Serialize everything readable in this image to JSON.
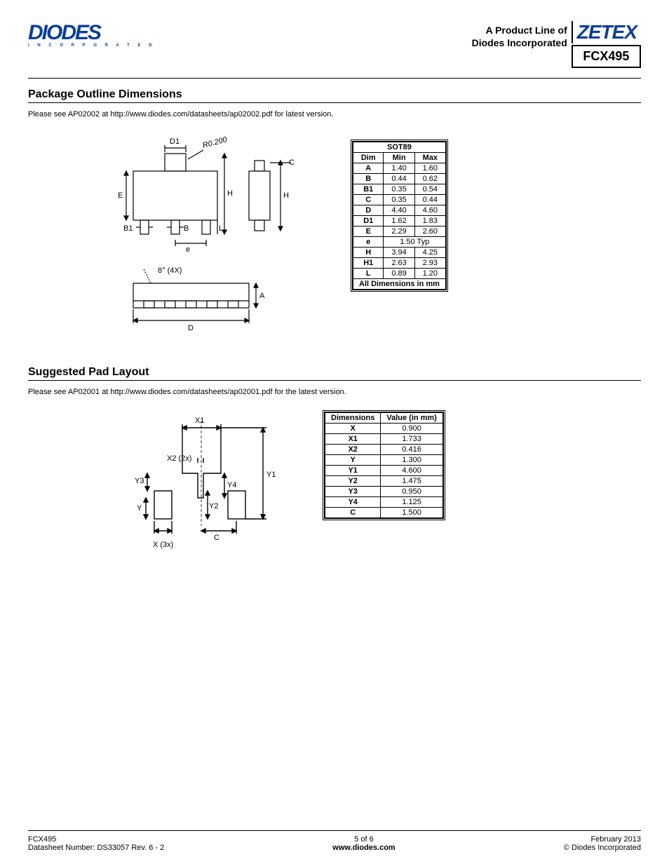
{
  "header": {
    "logo_main": "DIODES",
    "logo_sub": "I N C O R P O R A T E D",
    "prodline1": "A Product Line of",
    "prodline2": "Diodes Incorporated",
    "zetex": "ZETEX",
    "part": "FCX495"
  },
  "section1": {
    "title": "Package Outline Dimensions",
    "note": "Please see AP02002 at http://www.diodes.com/datasheets/ap02002.pdf for latest version.",
    "table_title": "SOT89",
    "headers": [
      "Dim",
      "Min",
      "Max"
    ],
    "rows": [
      {
        "dim": "A",
        "min": "1.40",
        "max": "1.60"
      },
      {
        "dim": "B",
        "min": "0.44",
        "max": "0.62"
      },
      {
        "dim": "B1",
        "min": "0.35",
        "max": "0.54"
      },
      {
        "dim": "C",
        "min": "0.35",
        "max": "0.44"
      },
      {
        "dim": "D",
        "min": "4.40",
        "max": "4.60"
      },
      {
        "dim": "D1",
        "min": "1.62",
        "max": "1.83"
      },
      {
        "dim": "E",
        "min": "2.29",
        "max": "2.60"
      },
      {
        "dim": "e",
        "span": "1.50 Typ"
      },
      {
        "dim": "H",
        "min": "3.94",
        "max": "4.25"
      },
      {
        "dim": "H1",
        "min": "2.63",
        "max": "2.93"
      },
      {
        "dim": "L",
        "min": "0.89",
        "max": "1.20"
      }
    ],
    "footer_text": "All Dimensions in mm",
    "diagram_labels": {
      "D1": "D1",
      "R": "R0.200",
      "C": "C",
      "E": "E",
      "H": "H",
      "H2": "H",
      "B1": "B1",
      "B": "B",
      "L": "L",
      "e": "e",
      "angle": "8° (4X)",
      "A": "A",
      "D": "D"
    }
  },
  "section2": {
    "title": "Suggested Pad Layout",
    "note": "Please see AP02001 at http://www.diodes.com/datasheets/ap02001.pdf for the latest version.",
    "headers": [
      "Dimensions",
      "Value (in mm)"
    ],
    "rows": [
      {
        "dim": "X",
        "val": "0.900"
      },
      {
        "dim": "X1",
        "val": "1.733"
      },
      {
        "dim": "X2",
        "val": "0.416"
      },
      {
        "dim": "Y",
        "val": "1.300"
      },
      {
        "dim": "Y1",
        "val": "4.600"
      },
      {
        "dim": "Y2",
        "val": "1.475"
      },
      {
        "dim": "Y3",
        "val": "0.950"
      },
      {
        "dim": "Y4",
        "val": "1.125"
      },
      {
        "dim": "C",
        "val": "1.500"
      }
    ],
    "diagram_labels": {
      "X1": "X1",
      "X2": "X2 (2x)",
      "Y1": "Y1",
      "Y3": "Y3",
      "Y4": "Y4",
      "Y2": "Y2",
      "Y": "Y",
      "C": "C",
      "X": "X (3x)"
    }
  },
  "footer": {
    "left1": "FCX495",
    "left2": "Datasheet Number: DS33057 Rev. 6 - 2",
    "center1": "5 of 6",
    "center2": "www.diodes.com",
    "right1": "February 2013",
    "right2": "© Diodes Incorporated"
  }
}
